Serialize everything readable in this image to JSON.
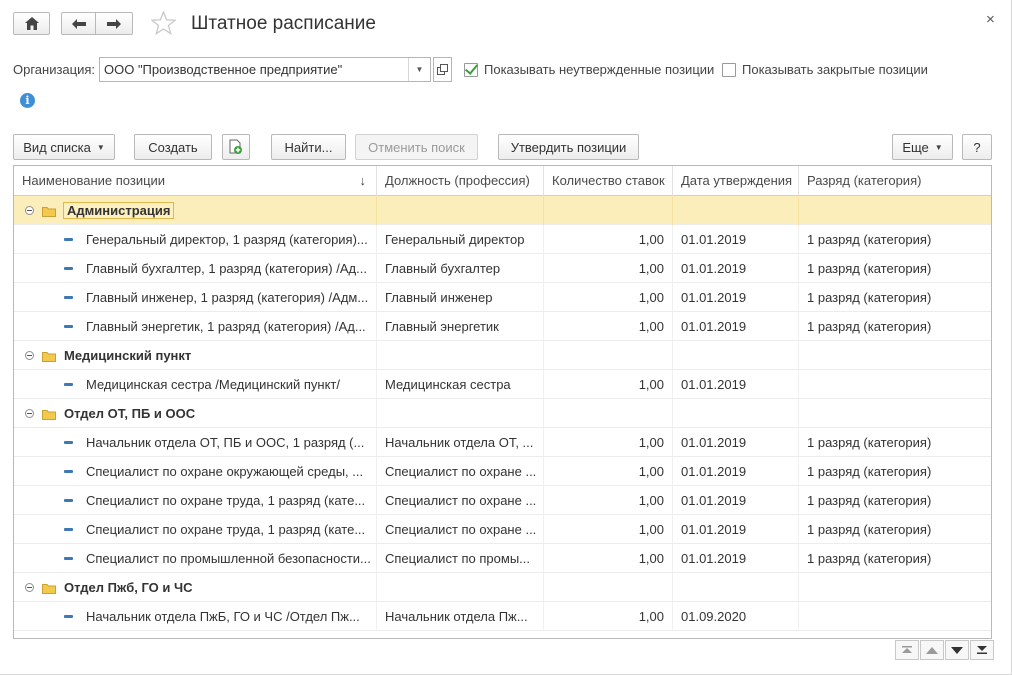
{
  "header": {
    "title": "Штатное расписание",
    "close": "×"
  },
  "filters": {
    "org_label": "Организация:",
    "org_value": "ООО \"Производственное предприятие\"",
    "show_unapproved_label": "Показывать неутвержденные позиции",
    "show_unapproved_checked": true,
    "show_closed_label": "Показывать закрытые позиции",
    "show_closed_checked": false,
    "info": "i"
  },
  "toolbar": {
    "view_list": "Вид списка",
    "create": "Создать",
    "find": "Найти...",
    "cancel_search": "Отменить поиск",
    "approve": "Утвердить позиции",
    "more": "Еще",
    "help": "?"
  },
  "table": {
    "columns": [
      "Наименование позиции",
      "Должность (профессия)",
      "Количество ставок",
      "Дата утверждения",
      "Разряд (категория)"
    ],
    "sort_indicator": "↓",
    "groups": [
      {
        "name": "Администрация",
        "rows": [
          {
            "name": "Генеральный директор, 1 разряд (категория)...",
            "position": "Генеральный директор",
            "count": "1,00",
            "date": "01.01.2019",
            "grade": "1 разряд (категория)"
          },
          {
            "name": "Главный бухгалтер, 1 разряд (категория) /Ад...",
            "position": "Главный бухгалтер",
            "count": "1,00",
            "date": "01.01.2019",
            "grade": "1 разряд (категория)"
          },
          {
            "name": "Главный инженер, 1 разряд (категория) /Адм...",
            "position": "Главный инженер",
            "count": "1,00",
            "date": "01.01.2019",
            "grade": "1 разряд (категория)"
          },
          {
            "name": "Главный энергетик, 1 разряд (категория) /Ад...",
            "position": "Главный энергетик",
            "count": "1,00",
            "date": "01.01.2019",
            "grade": "1 разряд (категория)"
          }
        ]
      },
      {
        "name": "Медицинский пункт",
        "rows": [
          {
            "name": "Медицинская сестра /Медицинский пункт/",
            "position": "Медицинская сестра",
            "count": "1,00",
            "date": "01.01.2019",
            "grade": ""
          }
        ]
      },
      {
        "name": "Отдел ОТ, ПБ и ООС",
        "rows": [
          {
            "name": "Начальник отдела ОТ, ПБ и ООС, 1 разряд (...",
            "position": "Начальник отдела ОТ, ...",
            "count": "1,00",
            "date": "01.01.2019",
            "grade": "1 разряд (категория)"
          },
          {
            "name": "Специалист по охране окружающей среды, ...",
            "position": "Специалист по охране ...",
            "count": "1,00",
            "date": "01.01.2019",
            "grade": "1 разряд (категория)"
          },
          {
            "name": "Специалист по охране труда, 1 разряд (кате...",
            "position": "Специалист по охране ...",
            "count": "1,00",
            "date": "01.01.2019",
            "grade": "1 разряд (категория)"
          },
          {
            "name": "Специалист по охране труда, 1 разряд (кате...",
            "position": "Специалист по охране ...",
            "count": "1,00",
            "date": "01.01.2019",
            "grade": "1 разряд (категория)"
          },
          {
            "name": "Специалист по промышленной безопасности...",
            "position": "Специалист по промы...",
            "count": "1,00",
            "date": "01.01.2019",
            "grade": "1 разряд (категория)"
          }
        ]
      },
      {
        "name": "Отдел Пжб, ГО и ЧС",
        "rows": [
          {
            "name": "Начальник отдела ПжБ, ГО и ЧС /Отдел Пж...",
            "position": "Начальник отдела Пж...",
            "count": "1,00",
            "date": "01.09.2020",
            "grade": ""
          }
        ]
      }
    ]
  },
  "colors": {
    "selected_row": "#fbeeba",
    "folder": "#f2c94c",
    "item_marker": "#3f78b6",
    "check": "#3a9e3a"
  }
}
